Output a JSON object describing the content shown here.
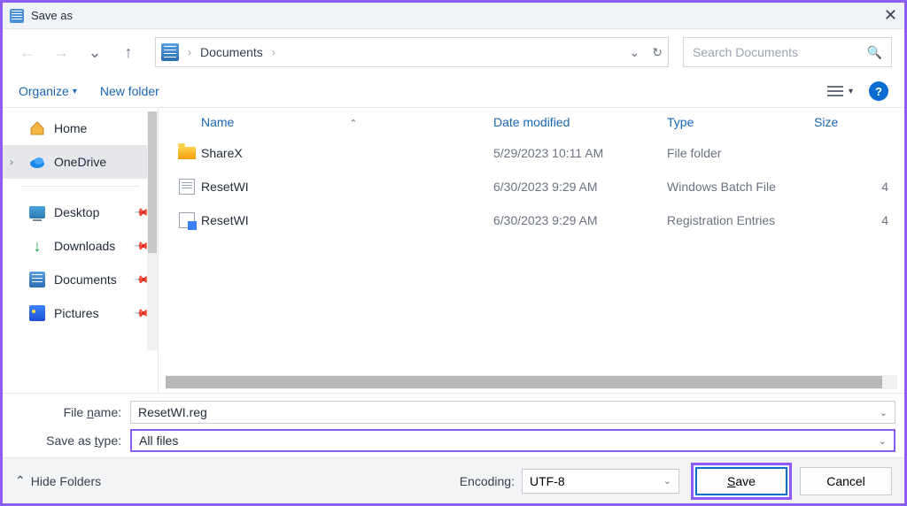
{
  "title": "Save as",
  "nav": {
    "location": "Documents"
  },
  "search": {
    "placeholder": "Search Documents"
  },
  "toolbar": {
    "organize": "Organize",
    "newfolder": "New folder"
  },
  "sidebar": {
    "home": "Home",
    "onedrive": "OneDrive",
    "desktop": "Desktop",
    "downloads": "Downloads",
    "documents": "Documents",
    "pictures": "Pictures"
  },
  "columns": {
    "name": "Name",
    "date": "Date modified",
    "type": "Type",
    "size": "Size"
  },
  "files": [
    {
      "name": "ShareX",
      "date": "5/29/2023 10:11 AM",
      "type": "File folder",
      "size": "",
      "icon": "folder"
    },
    {
      "name": "ResetWI",
      "date": "6/30/2023 9:29 AM",
      "type": "Windows Batch File",
      "size": "4",
      "icon": "bat"
    },
    {
      "name": "ResetWI",
      "date": "6/30/2023 9:29 AM",
      "type": "Registration Entries",
      "size": "4",
      "icon": "reg"
    }
  ],
  "form": {
    "filename_label": "File name:",
    "filename_value": "ResetWI.reg",
    "savetype_label": "Save as type:",
    "savetype_value": "All files"
  },
  "footer": {
    "hide": "Hide Folders",
    "encoding_label": "Encoding:",
    "encoding_value": "UTF-8",
    "save": "Save",
    "cancel": "Cancel"
  }
}
